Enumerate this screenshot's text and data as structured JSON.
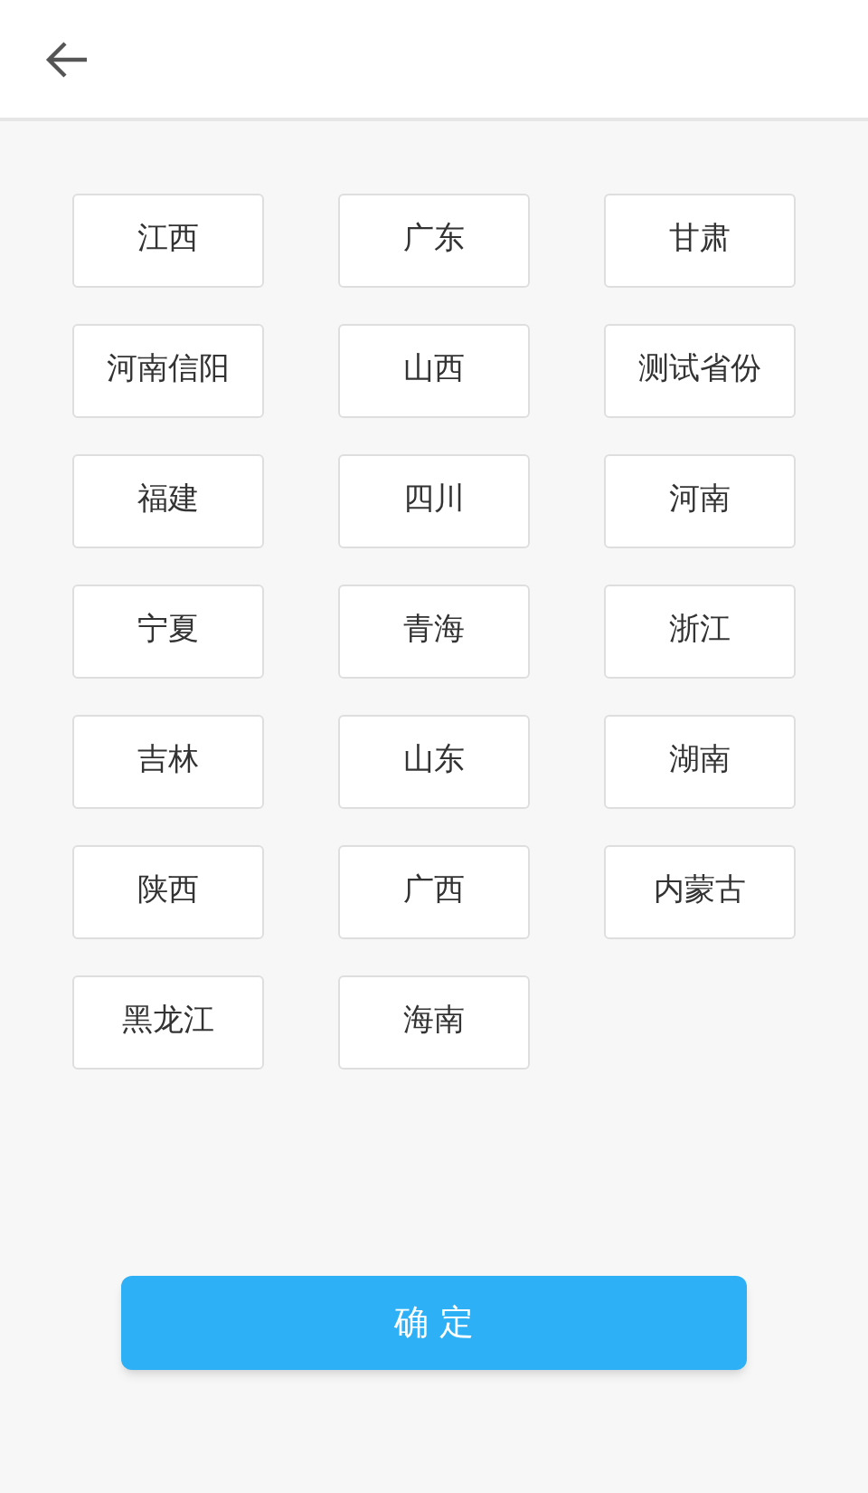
{
  "provinces": [
    "江西",
    "广东",
    "甘肃",
    "河南信阳",
    "山西",
    "测试省份",
    "福建",
    "四川",
    "河南",
    "宁夏",
    "青海",
    "浙江",
    "吉林",
    "山东",
    "湖南",
    "陕西",
    "广西",
    "内蒙古",
    "黑龙江",
    "海南"
  ],
  "confirm_button": "确 定"
}
